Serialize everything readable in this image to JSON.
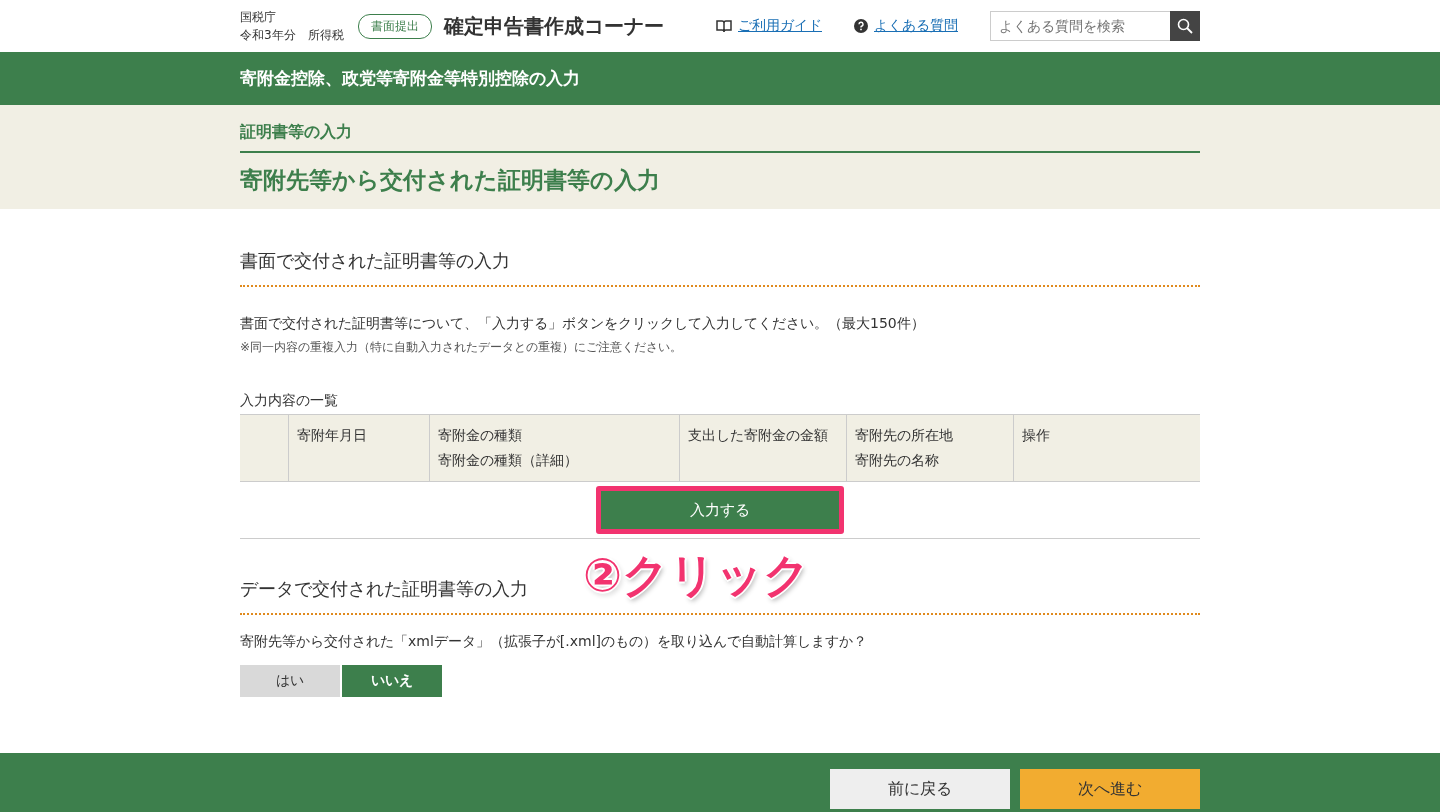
{
  "header": {
    "agency": "国税庁",
    "year_tax": "令和3年分　所得税",
    "mode_badge": "書面提出",
    "site_title": "確定申告書作成コーナー",
    "links": [
      {
        "kind": "guide",
        "label": "ご利用ガイド"
      },
      {
        "kind": "faq",
        "label": "よくある質問"
      }
    ],
    "search": {
      "placeholder": "よくある質問を検索"
    }
  },
  "page_title": "寄附金控除、政党等寄附金等特別控除の入力",
  "breadcrumb": "証明書等の入力",
  "heading": "寄附先等から交付された証明書等の入力",
  "paper_section": {
    "title": "書面で交付された証明書等の入力",
    "description": "書面で交付された証明書等について、「入力する」ボタンをクリックして入力してください。（最大150件）",
    "note": "※同一内容の重複入力（特に自動入力されたデータとの重複）にご注意ください。",
    "table_caption": "入力内容の一覧",
    "columns": [
      [],
      [
        "寄附年月日"
      ],
      [
        "寄附金の種類",
        "寄附金の種類（詳細）"
      ],
      [
        "支出した寄附金の金額"
      ],
      [
        "寄附先の所在地",
        "寄附先の名称"
      ],
      [
        "操作"
      ]
    ],
    "input_button": "入力する"
  },
  "annotation": "②クリック",
  "data_section": {
    "title": "データで交付された証明書等の入力",
    "question": "寄附先等から交付された「xmlデータ」（拡張子が[.xml]のもの）を取り込んで自動計算しますか？",
    "options": [
      {
        "label": "はい",
        "selected": false
      },
      {
        "label": "いいえ",
        "selected": true
      }
    ]
  },
  "footer": {
    "back": "前に戻る",
    "next": "次へ進む"
  }
}
